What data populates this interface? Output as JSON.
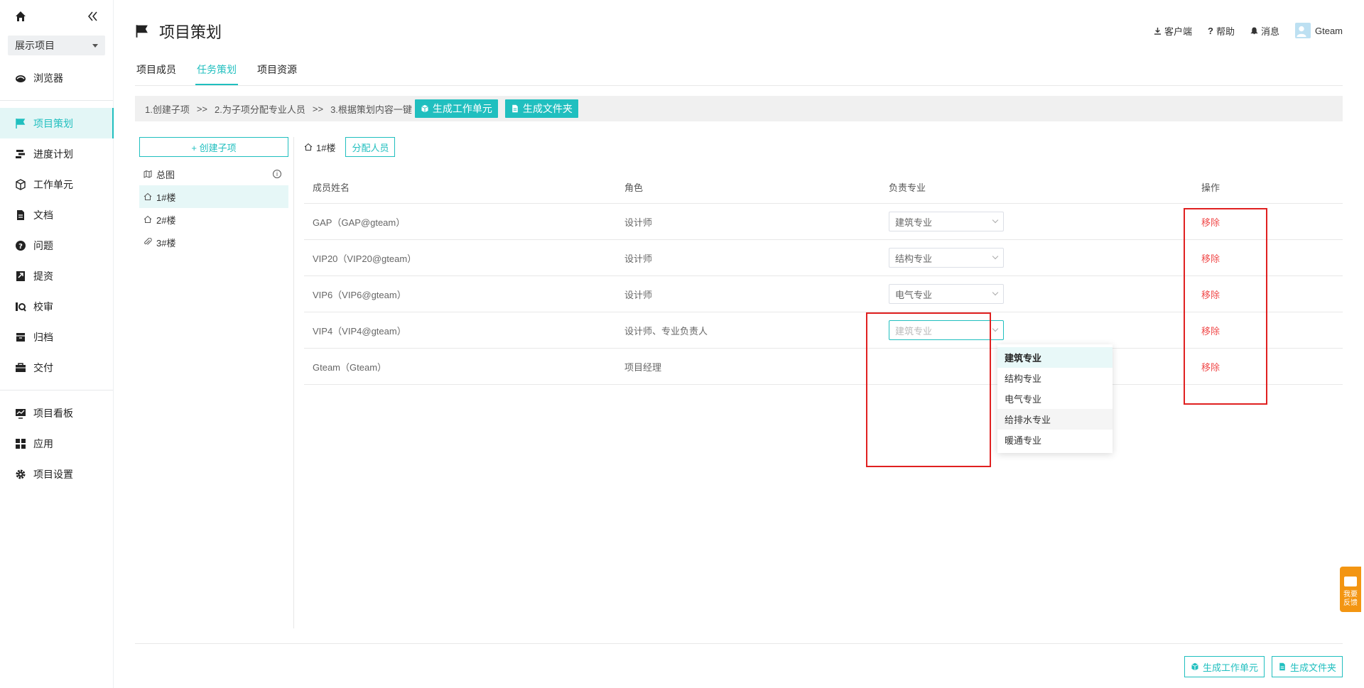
{
  "sidebar": {
    "project_select": "展示项目",
    "items": [
      {
        "label": "浏览器",
        "icon": "browser-icon"
      },
      {
        "label": "项目策划",
        "icon": "flag-icon",
        "active": true
      },
      {
        "label": "进度计划",
        "icon": "schedule-icon"
      },
      {
        "label": "工作单元",
        "icon": "cube-icon"
      },
      {
        "label": "文档",
        "icon": "document-icon"
      },
      {
        "label": "问题",
        "icon": "question-icon"
      },
      {
        "label": "提资",
        "icon": "submit-icon"
      },
      {
        "label": "校审",
        "icon": "review-icon"
      },
      {
        "label": "归档",
        "icon": "archive-icon"
      },
      {
        "label": "交付",
        "icon": "briefcase-icon"
      },
      {
        "label": "项目看板",
        "icon": "dashboard-icon"
      },
      {
        "label": "应用",
        "icon": "apps-icon"
      },
      {
        "label": "项目设置",
        "icon": "gear-icon"
      }
    ]
  },
  "header": {
    "title": "项目策划",
    "client": "客户端",
    "help": "帮助",
    "messages": "消息",
    "user": "Gteam"
  },
  "tabs": [
    {
      "label": "项目成员"
    },
    {
      "label": "任务策划",
      "active": true
    },
    {
      "label": "项目资源"
    }
  ],
  "steps": {
    "step1": "1.创建子项",
    "sep1": ">>",
    "step2": "2.为子项分配专业人员",
    "sep2": ">>",
    "step3": "3.根据策划内容一键",
    "btn_work_unit": "生成工作单元",
    "btn_folder": "生成文件夹"
  },
  "tree": {
    "create_button": "+ 创建子项",
    "items": [
      {
        "label": "总图",
        "icon": "map-icon"
      },
      {
        "label": "1#楼",
        "icon": "house-icon",
        "selected": true
      },
      {
        "label": "2#楼",
        "icon": "house-icon"
      },
      {
        "label": "3#楼",
        "icon": "paperclip-icon"
      }
    ]
  },
  "panel": {
    "current": "1#楼",
    "assign_button": "分配人员"
  },
  "table": {
    "headers": [
      "成员姓名",
      "角色",
      "负责专业",
      "操作"
    ],
    "rows": [
      {
        "name": "GAP（GAP@gteam）",
        "role": "设计师",
        "discipline": "建筑专业",
        "action": "移除"
      },
      {
        "name": "VIP20（VIP20@gteam）",
        "role": "设计师",
        "discipline": "结构专业",
        "action": "移除"
      },
      {
        "name": "VIP6（VIP6@gteam）",
        "role": "设计师",
        "discipline": "电气专业",
        "action": "移除"
      },
      {
        "name": "VIP4（VIP4@gteam）",
        "role": "设计师、专业负责人",
        "discipline": "建筑专业",
        "action": "移除"
      },
      {
        "name": "Gteam（Gteam）",
        "role": "项目经理",
        "discipline": "",
        "action": "移除"
      }
    ]
  },
  "dropdown": {
    "options": [
      "建筑专业",
      "结构专业",
      "电气专业",
      "给排水专业",
      "暖通专业"
    ]
  },
  "bottom": {
    "btn_work_unit": "生成工作单元",
    "btn_folder": "生成文件夹"
  },
  "feedback": {
    "line1": "我要",
    "line2": "反馈"
  },
  "colors": {
    "accent": "#20bfbf",
    "danger": "#f04b4b",
    "highlight": "#e02020",
    "feedback": "#f39512"
  }
}
